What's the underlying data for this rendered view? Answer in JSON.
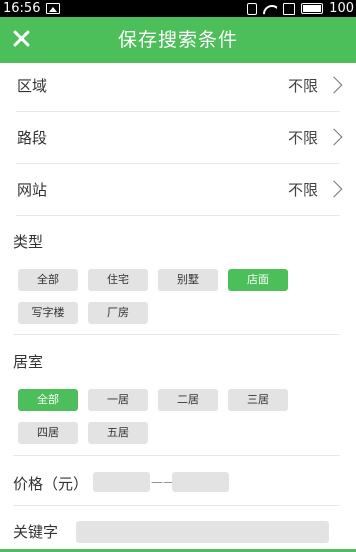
{
  "status": {
    "time": "16:56",
    "battery": "100"
  },
  "header": {
    "title": "保存搜索条件"
  },
  "filters": [
    {
      "label": "区域",
      "value": "不限"
    },
    {
      "label": "路段",
      "value": "不限"
    },
    {
      "label": "网站",
      "value": "不限"
    }
  ],
  "type_section": {
    "title": "类型",
    "options": [
      "全部",
      "住宅",
      "别墅",
      "店面",
      "写字楼",
      "厂房"
    ],
    "selected": "店面"
  },
  "room_section": {
    "title": "居室",
    "options": [
      "全部",
      "一居",
      "二居",
      "三居",
      "四居",
      "五居"
    ],
    "selected": "全部"
  },
  "price": {
    "label": "价格（元）",
    "separator": "——",
    "min_value": "",
    "max_value": ""
  },
  "keyword": {
    "label": "关键字",
    "value": ""
  },
  "colors": {
    "accent": "#4cbf5a",
    "chip_bg": "#e3e3e3"
  }
}
